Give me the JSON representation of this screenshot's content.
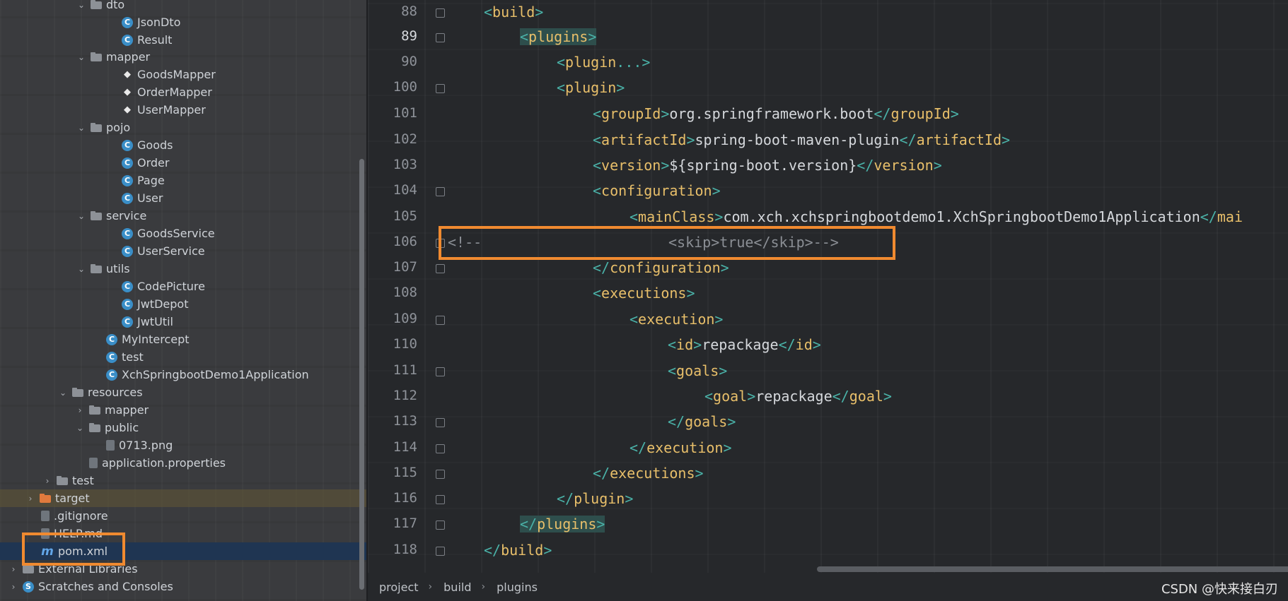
{
  "project_tree": {
    "items": [
      {
        "label": "dto",
        "icon": "folder-icon",
        "expanded": true
      },
      {
        "label": "JsonDto",
        "icon": "class-icon"
      },
      {
        "label": "Result",
        "icon": "class-icon"
      },
      {
        "label": "mapper",
        "icon": "folder-icon",
        "expanded": true
      },
      {
        "label": "GoodsMapper",
        "icon": "mapper-interface-icon"
      },
      {
        "label": "OrderMapper",
        "icon": "mapper-interface-icon"
      },
      {
        "label": "UserMapper",
        "icon": "mapper-interface-icon"
      },
      {
        "label": "pojo",
        "icon": "folder-icon",
        "expanded": true
      },
      {
        "label": "Goods",
        "icon": "class-icon"
      },
      {
        "label": "Order",
        "icon": "class-icon"
      },
      {
        "label": "Page",
        "icon": "class-icon"
      },
      {
        "label": "User",
        "icon": "class-icon"
      },
      {
        "label": "service",
        "icon": "folder-icon",
        "expanded": true
      },
      {
        "label": "GoodsService",
        "icon": "class-icon"
      },
      {
        "label": "UserService",
        "icon": "class-icon"
      },
      {
        "label": "utils",
        "icon": "folder-icon",
        "expanded": true
      },
      {
        "label": "CodePicture",
        "icon": "class-icon"
      },
      {
        "label": "JwtDepot",
        "icon": "class-icon"
      },
      {
        "label": "JwtUtil",
        "icon": "class-icon"
      },
      {
        "label": "MyIntercept",
        "icon": "class-icon"
      },
      {
        "label": "test",
        "icon": "class-icon"
      },
      {
        "label": "XchSpringbootDemo1Application",
        "icon": "spring-app-icon"
      },
      {
        "label": "resources",
        "icon": "folder-icon",
        "expanded": true
      },
      {
        "label": "mapper",
        "icon": "folder-icon",
        "expanded": false
      },
      {
        "label": "public",
        "icon": "folder-icon",
        "expanded": true
      },
      {
        "label": "0713.png",
        "icon": "image-file-icon"
      },
      {
        "label": "application.properties",
        "icon": "properties-file-icon"
      },
      {
        "label": "test",
        "icon": "folder-icon",
        "expanded": false
      },
      {
        "label": "target",
        "icon": "folder-icon",
        "expanded": false
      },
      {
        "label": ".gitignore",
        "icon": "gitignore-file-icon"
      },
      {
        "label": "HELP.md",
        "icon": "markdown-file-icon"
      },
      {
        "label": "pom.xml",
        "icon": "maven-xml-icon",
        "selected": true
      },
      {
        "label": "External Libraries",
        "icon": "libraries-icon",
        "expanded": false
      },
      {
        "label": "Scratches and Consoles",
        "icon": "scratches-icon",
        "expanded": false
      }
    ]
  },
  "editor": {
    "line_numbers": [
      "88",
      "89",
      "90",
      "100",
      "101",
      "102",
      "103",
      "104",
      "105",
      "106",
      "107",
      "108",
      "109",
      "110",
      "111",
      "112",
      "113",
      "114",
      "115",
      "116",
      "117",
      "118"
    ],
    "current_line": "89",
    "lines": {
      "l88_tag": "build",
      "l89_tag": "plugins",
      "l90_tag": "plugin",
      "l90_dots": "...",
      "l100_tag": "plugin",
      "l101_open": "groupId",
      "l101_text": "org.springframework.boot",
      "l101_close": "groupId",
      "l102_open": "artifactId",
      "l102_text": "spring-boot-maven-plugin",
      "l102_close": "artifactId",
      "l103_open": "version",
      "l103_text": "${spring-boot.version}",
      "l103_close": "version",
      "l104_tag": "configuration",
      "l105_open": "mainClass",
      "l105_text": "com.xch.xchspringbootdemo1.XchSpringbootDemo1Application",
      "l105_close": "mai",
      "l106_comment_open": "<!--",
      "l106_comment_body": "<skip>true</skip>-->",
      "l107_tag": "configuration",
      "l108_tag": "executions",
      "l109_tag": "execution",
      "l110_open": "id",
      "l110_text": "repackage",
      "l110_close": "id",
      "l111_tag": "goals",
      "l112_open": "goal",
      "l112_text": "repackage",
      "l112_close": "goal",
      "l113_tag": "goals",
      "l114_tag": "execution",
      "l115_tag": "executions",
      "l116_tag": "plugin",
      "l117_tag": "plugins",
      "l118_tag": "build"
    }
  },
  "breadcrumbs": [
    "project",
    "build",
    "plugins"
  ],
  "watermark": "CSDN @快来接白刃",
  "colors": {
    "tag_bracket": "#4ab2a8",
    "tag_name": "#e8bf6a",
    "highlight_box": "#f08a30",
    "selection": "#1f3552"
  }
}
